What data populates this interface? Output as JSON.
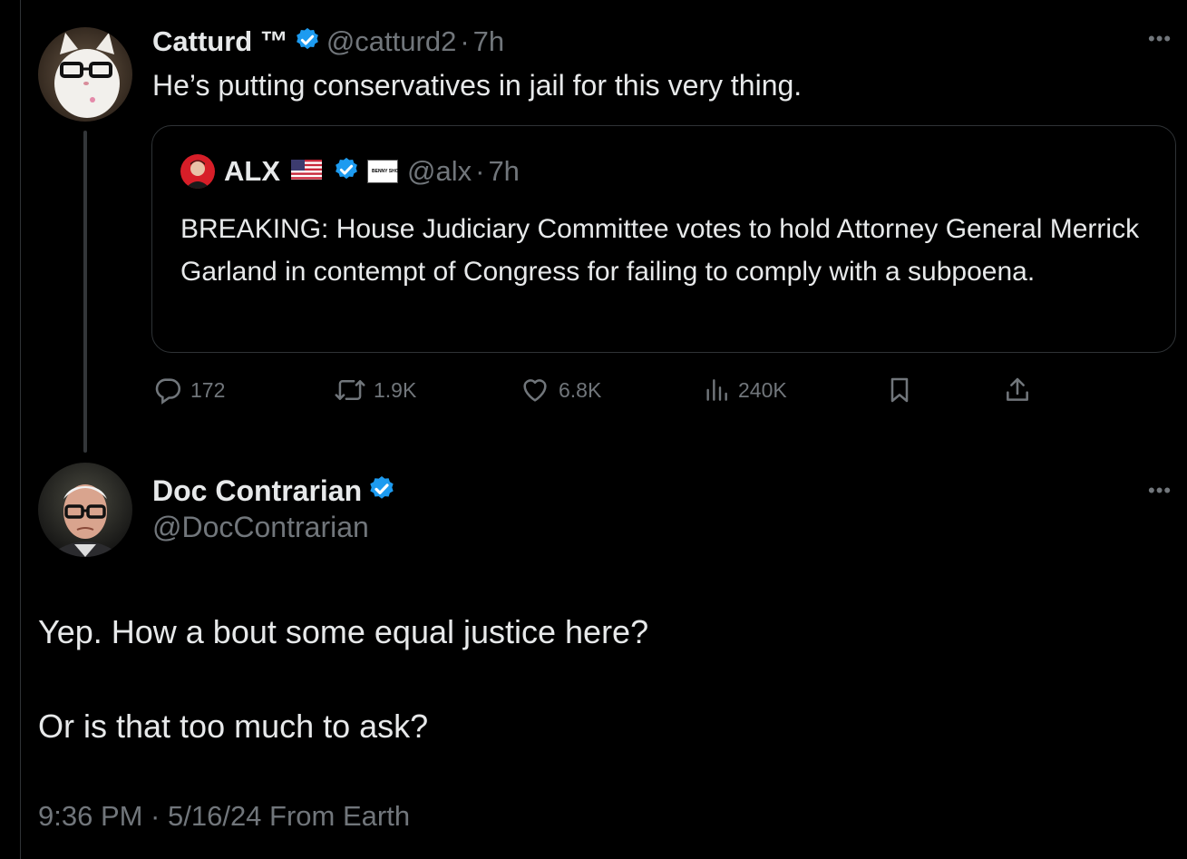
{
  "parent_tweet": {
    "display_name": "Catturd ™",
    "handle": "@catturd2",
    "separator": "·",
    "time": "7h",
    "text": "He’s putting conservatives in jail for this very thing.",
    "avatar_icon": "cat-with-glasses-avatar",
    "quoted": {
      "display_name": "ALX",
      "flag_icon": "us-flag-icon",
      "badge_text": "BENNY SHOW",
      "handle": "@alx",
      "separator": "·",
      "time": "7h",
      "text": "BREAKING: House Judiciary Committee votes to hold Attorney General Merrick Garland in contempt of Congress for failing to comply with a subpoena."
    },
    "actions": {
      "replies": "172",
      "reposts": "1.9K",
      "likes": "6.8K",
      "views": "240K"
    }
  },
  "main_tweet": {
    "display_name": "Doc Contrarian",
    "handle": "@DocContrarian",
    "avatar_icon": "older-man-with-glasses-avatar",
    "text_line_1": "Yep. How a bout some equal justice here?",
    "text_line_2": "Or is that too much to ask?",
    "timestamp": "9:36 PM · 5/16/24 From Earth"
  },
  "colors": {
    "background": "#000000",
    "text": "#e7e9ea",
    "secondary": "#71767b",
    "verified": "#1d9bf0",
    "border": "#2f3336"
  }
}
